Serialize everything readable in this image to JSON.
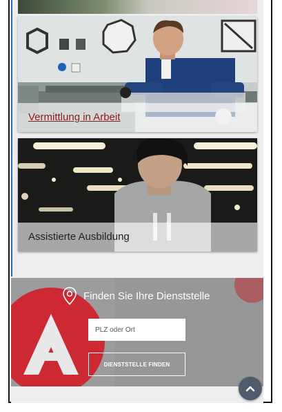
{
  "cards": [
    {
      "title": "Vermittlung in Arbeit"
    },
    {
      "title": "Assistierte Ausbildung"
    }
  ],
  "finder": {
    "title": "Finden Sie Ihre Dienststelle",
    "input_placeholder": "PLZ oder Ort",
    "button_label": "DIENSTSTELLE FINDEN"
  },
  "icons": {
    "location": "map-pin-icon",
    "back_to_top": "chevron-up-icon"
  },
  "colors": {
    "link": "#8a1c1c",
    "brand_red": "#d12029",
    "scroll_button": "#4f5b6b"
  }
}
